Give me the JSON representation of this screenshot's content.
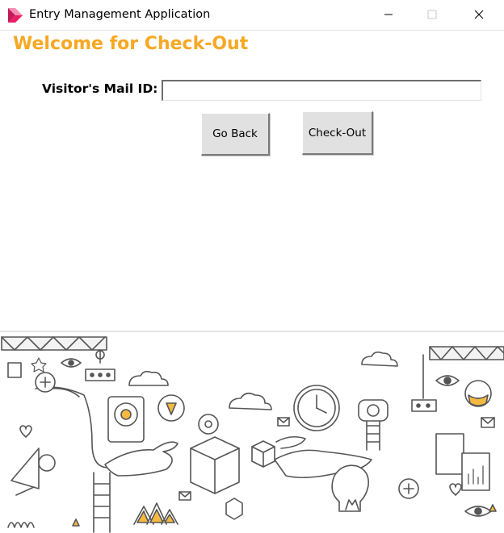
{
  "window": {
    "title": "Entry Management Application",
    "icon": "pink-arrow-logo-icon"
  },
  "page": {
    "heading": "Welcome for Check-Out",
    "mail_label": "Visitor's Mail ID:",
    "mail_value": ""
  },
  "buttons": {
    "back_label": "Go Back",
    "checkout_label": "Check-Out"
  },
  "colors": {
    "heading": "#f7a823",
    "button_face": "#e1e1e1",
    "illustration_line": "#555555",
    "illustration_accent": "#f5b942"
  },
  "illustration": {
    "description_icon": "doodle-technology-illustration"
  }
}
